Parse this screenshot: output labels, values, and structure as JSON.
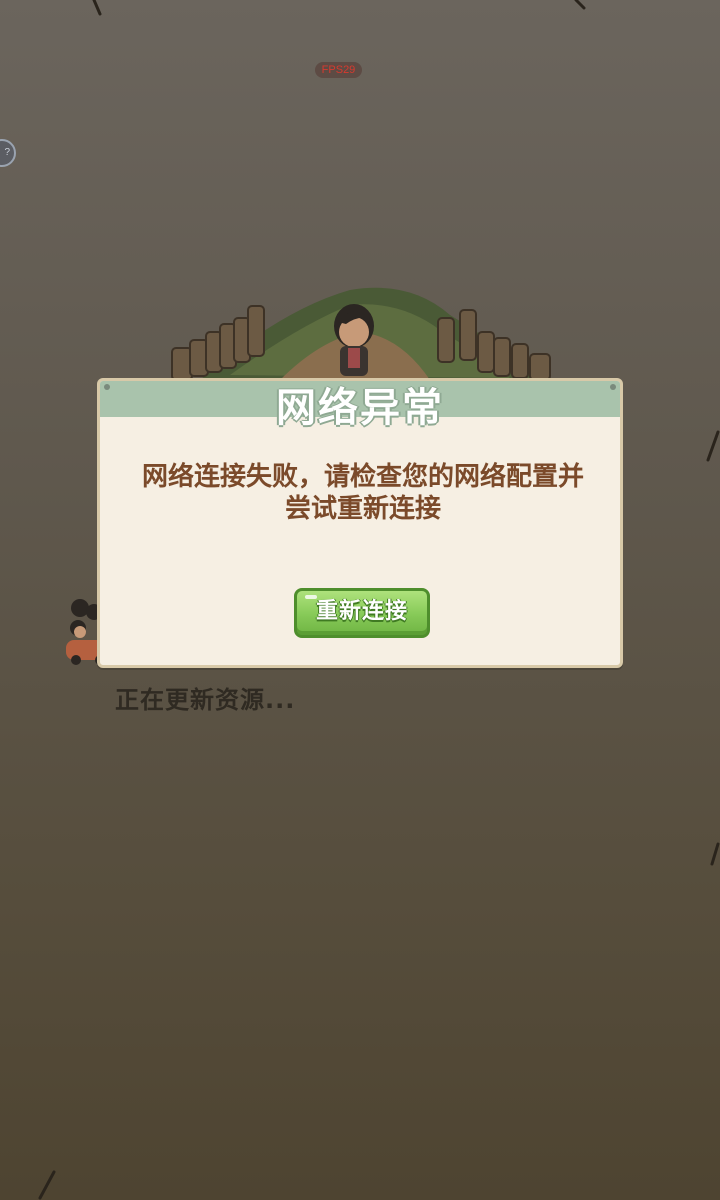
{
  "hud": {
    "fps_label": "FPS29",
    "side_button_label": "?"
  },
  "loading": {
    "status_text": "正在更新资源..."
  },
  "dialog": {
    "title": "网络异常",
    "message": "网络连接失败，请检查您的网络配置并尝试重新连接",
    "reconnect_label": "重新连接"
  },
  "colors": {
    "background": "#5f584d",
    "dialog_body": "#f6efe3",
    "dialog_header": "#a9c3ac",
    "message_text": "#7b4a2a",
    "button_green": "#86c957",
    "fps_text": "#d63a2f"
  }
}
